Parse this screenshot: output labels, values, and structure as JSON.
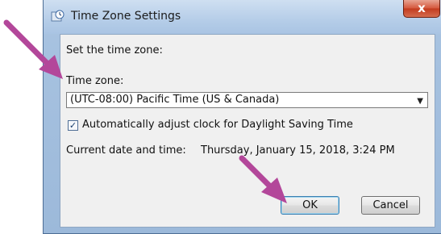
{
  "window": {
    "title": "Time Zone Settings",
    "close_glyph": "x",
    "close_icon": "close-icon",
    "title_icon": "clock-settings-icon"
  },
  "dialog": {
    "instruction": "Set the time zone:",
    "timezone_label": "Time zone:",
    "timezone_selected": "(UTC-08:00) Pacific Time (US & Canada)",
    "dst_checkbox_label": "Automatically adjust clock for Daylight Saving Time",
    "dst_checked": true,
    "current_label": "Current date and time:",
    "current_value": "Thursday, January 15, 2018, 3:24 PM",
    "ok_label": "OK",
    "cancel_label": "Cancel"
  },
  "annotations": {
    "arrow_color": "#b3479a"
  }
}
